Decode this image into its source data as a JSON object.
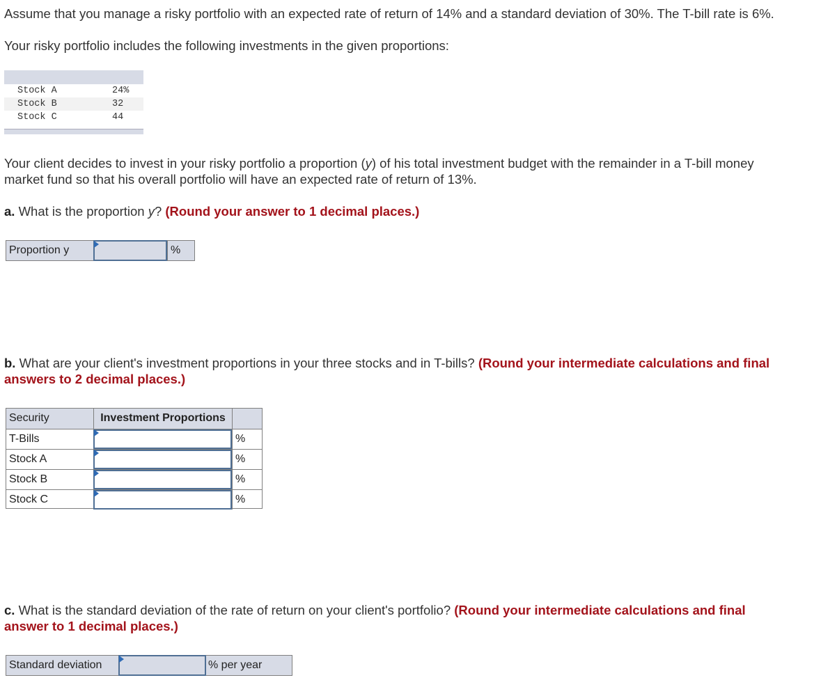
{
  "intro": {
    "line1": "Assume that you manage a risky portfolio with an expected rate of return of 14% and a standard deviation of 30%. The T-bill rate is 6%.",
    "line2": "Your risky portfolio includes the following investments in the given proportions:"
  },
  "given_table": {
    "rows": [
      {
        "name": "Stock A",
        "value": "24%"
      },
      {
        "name": "Stock B",
        "value": "32"
      },
      {
        "name": "Stock C",
        "value": "44"
      }
    ]
  },
  "client_text": {
    "line1_pre": "Your client decides to invest in your risky portfolio a proportion (",
    "var": "y",
    "line1_post": ") of his total investment budget with the remainder in a T-bill money",
    "line2": "market fund so that his overall portfolio will have an expected rate of return of 13%."
  },
  "question_a": {
    "label": "a.",
    "text_pre": " What is the proportion ",
    "var": "y",
    "text_post": "? ",
    "instruction": "(Round your answer to 1 decimal places.)",
    "field_label": "Proportion y",
    "field_value": "",
    "unit": "%"
  },
  "question_b": {
    "label": "b.",
    "text": " What are your client's investment proportions in your three stocks and in T-bills? ",
    "instruction_line1": "(Round your intermediate calculations and final",
    "instruction_line2": "answers to 2 decimal places.)",
    "col_security": "Security",
    "col_proportions": "Investment Proportions",
    "rows": [
      {
        "security": "T-Bills",
        "value": "",
        "unit": "%"
      },
      {
        "security": "Stock A",
        "value": "",
        "unit": "%"
      },
      {
        "security": "Stock B",
        "value": "",
        "unit": "%"
      },
      {
        "security": "Stock C",
        "value": "",
        "unit": "%"
      }
    ]
  },
  "question_c": {
    "label": "c.",
    "text": " What is the standard deviation of the rate of return on your client's portfolio? ",
    "instruction_line1": "(Round your intermediate calculations and final",
    "instruction_line2": "answer to 1 decimal places.)",
    "field_label": "Standard deviation",
    "field_value": "",
    "unit": "% per year"
  }
}
